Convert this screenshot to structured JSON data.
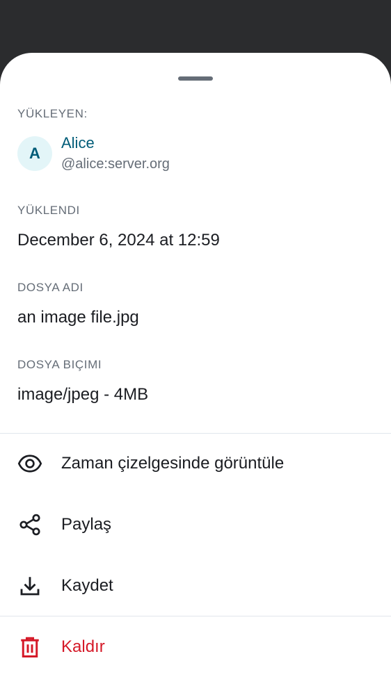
{
  "uploader": {
    "section_label": "YÜKLEYEN:",
    "avatar_initial": "A",
    "name": "Alice",
    "user_id": "@alice:server.org"
  },
  "uploaded": {
    "section_label": "YÜKLENDI",
    "value": "December 6, 2024 at 12:59"
  },
  "file_name": {
    "section_label": "DOSYA ADI",
    "value": "an image file.jpg"
  },
  "file_format": {
    "section_label": "DOSYA BIÇIMI",
    "value": "image/jpeg - 4MB"
  },
  "actions": [
    {
      "label": "Zaman çizelgesinde görüntüle",
      "icon": "eye-icon"
    },
    {
      "label": "Paylaş",
      "icon": "share-icon"
    },
    {
      "label": "Kaydet",
      "icon": "download-icon"
    },
    {
      "label": "Kaldır",
      "icon": "trash-icon"
    }
  ],
  "colors": {
    "background": "#2b2c2e",
    "sheet": "#ffffff",
    "secondary_text": "#656d77",
    "accent": "#005c78",
    "avatar_bg": "#e3f5f8",
    "danger": "#d51928"
  }
}
